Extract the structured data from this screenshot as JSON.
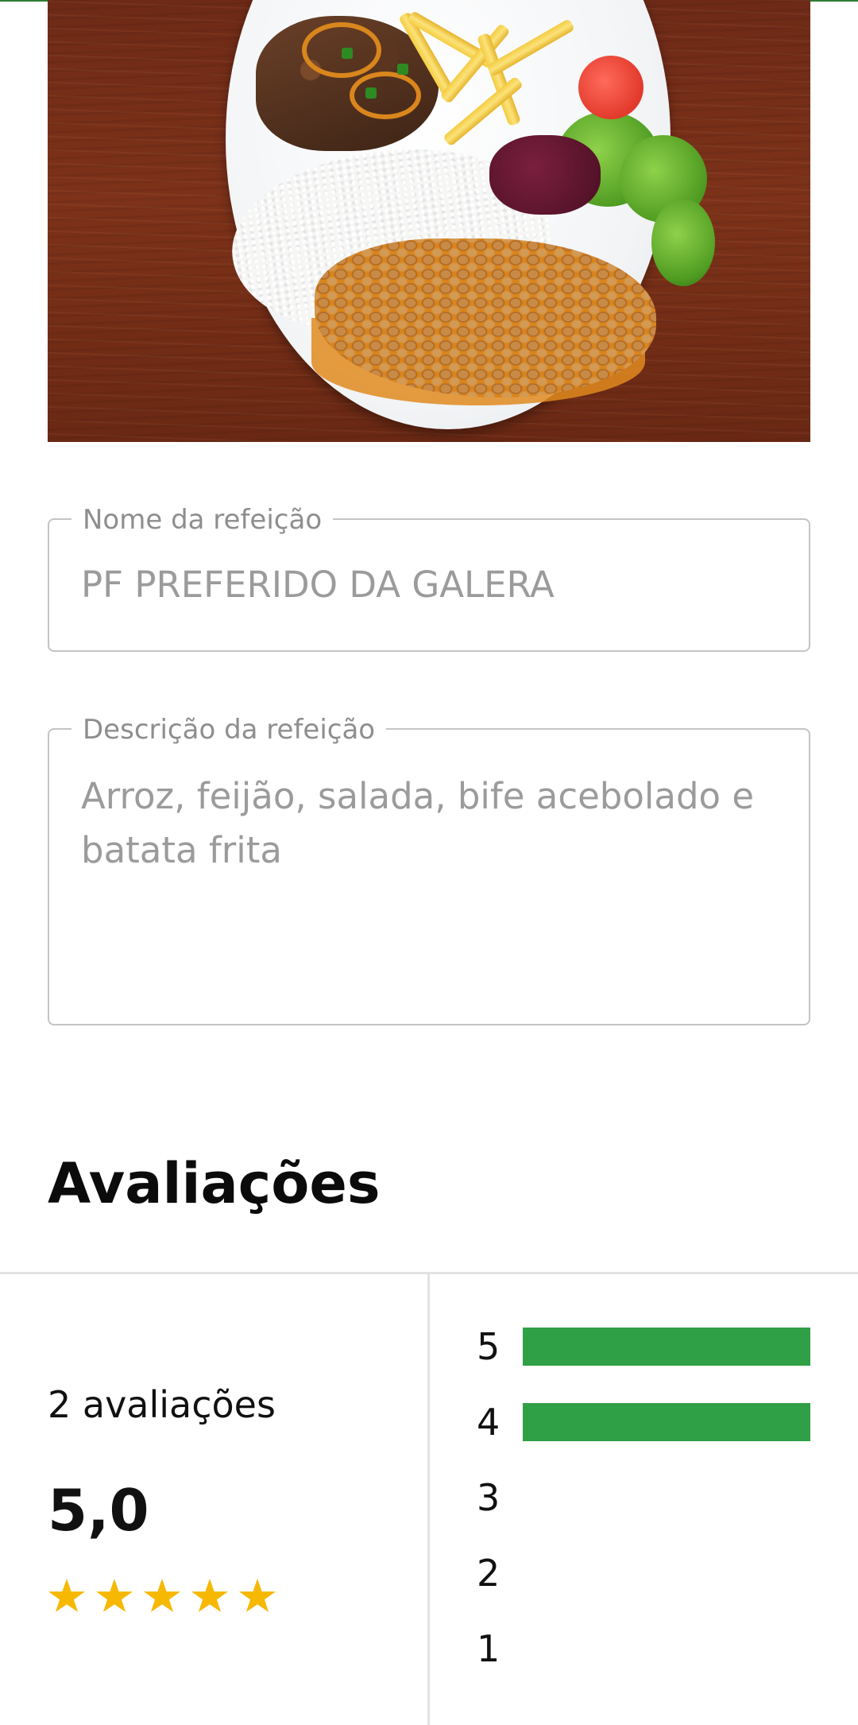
{
  "meal_photo": {
    "icon": "meal-photo-plate-rice-beans-steak-fries-salad"
  },
  "form": {
    "name_label": "Nome da refeição",
    "name_value": "PF PREFERIDO DA GALERA",
    "description_label": "Descrição da refeição",
    "description_value": "Arroz, feijão, salada, bife acebolado e batata frita"
  },
  "reviews": {
    "title": "Avaliações",
    "count_text": "2 avaliações",
    "average_text": "5,0",
    "average_value": 5,
    "star_count": 5,
    "distribution": [
      {
        "label": "5",
        "fraction": 1.0
      },
      {
        "label": "4",
        "fraction": 1.0
      },
      {
        "label": "3",
        "fraction": 0
      },
      {
        "label": "2",
        "fraction": 0
      },
      {
        "label": "1",
        "fraction": 0
      }
    ]
  },
  "colors": {
    "accent_green": "#30a046",
    "star_yellow": "#f6b800",
    "border_gray": "#c4c4c4"
  }
}
